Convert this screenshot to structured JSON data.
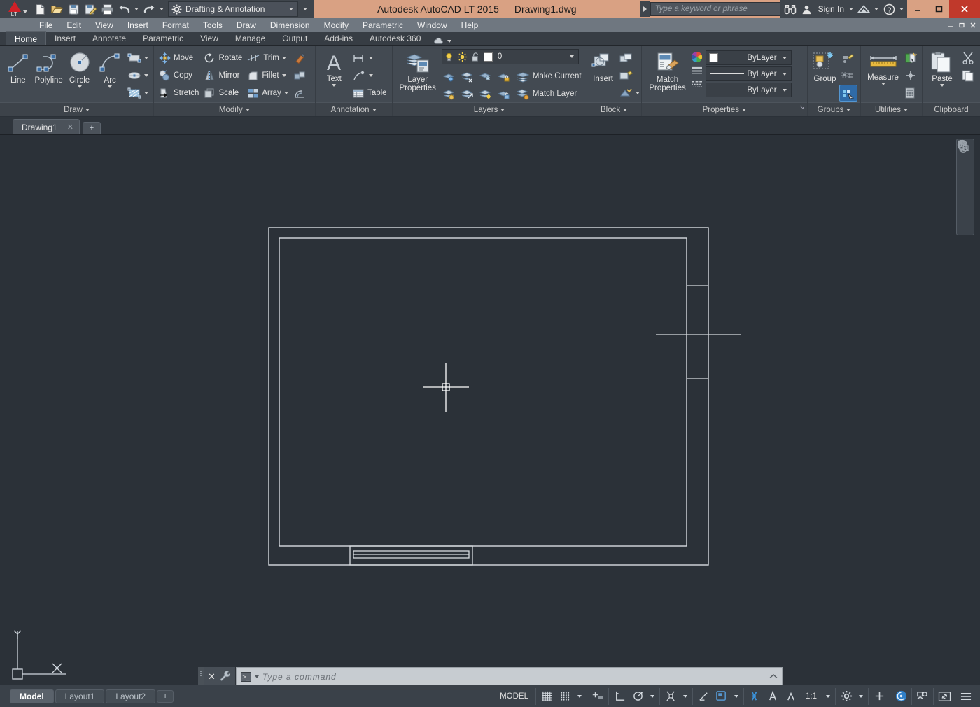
{
  "titlebar": {
    "workspace": "Drafting & Annotation",
    "app_title": "Autodesk AutoCAD LT 2015",
    "file_name": "Drawing1.dwg",
    "search_placeholder": "Type a keyword or phrase",
    "sign_in": "Sign In",
    "quick_access": [
      {
        "name": "new-file-icon",
        "label": "New"
      },
      {
        "name": "open-file-icon",
        "label": "Open"
      },
      {
        "name": "save-file-icon",
        "label": "Save"
      },
      {
        "name": "save-as-icon",
        "label": "Save As"
      },
      {
        "name": "plot-icon",
        "label": "Plot"
      },
      {
        "name": "undo-icon",
        "label": "Undo"
      },
      {
        "name": "redo-icon",
        "label": "Redo"
      }
    ],
    "window_buttons": [
      "minimize",
      "restore",
      "close"
    ]
  },
  "menubar": {
    "items": [
      "File",
      "Edit",
      "View",
      "Insert",
      "Format",
      "Tools",
      "Draw",
      "Dimension",
      "Modify",
      "Parametric",
      "Window",
      "Help"
    ]
  },
  "ribbon_tabs": {
    "items": [
      "Home",
      "Insert",
      "Annotate",
      "Parametric",
      "View",
      "Manage",
      "Output",
      "Add-ins",
      "Autodesk 360"
    ],
    "active": "Home"
  },
  "ribbon": {
    "panels": [
      {
        "title": "Draw",
        "big_buttons": [
          {
            "label": "Line",
            "icon": "line-icon",
            "dropdown": false
          },
          {
            "label": "Polyline",
            "icon": "polyline-icon",
            "dropdown": false
          },
          {
            "label": "Circle",
            "icon": "circle-icon",
            "dropdown": true
          },
          {
            "label": "Arc",
            "icon": "arc-icon",
            "dropdown": true
          }
        ],
        "small_buttons": [
          {
            "label": "",
            "icon": "rectangle-icon",
            "dropdown": true
          },
          {
            "label": "",
            "icon": "ellipse-icon",
            "dropdown": true
          },
          {
            "label": "",
            "icon": "hatch-icon",
            "dropdown": true
          }
        ]
      },
      {
        "title": "Modify",
        "small_buttons": [
          {
            "label": "Move",
            "icon": "move-icon"
          },
          {
            "label": "Rotate",
            "icon": "rotate-icon"
          },
          {
            "label": "Trim",
            "icon": "trim-icon",
            "dropdown": true
          },
          {
            "label": "Copy",
            "icon": "copy-icon"
          },
          {
            "label": "Mirror",
            "icon": "mirror-icon"
          },
          {
            "label": "Fillet",
            "icon": "fillet-icon",
            "dropdown": true
          },
          {
            "label": "Stretch",
            "icon": "stretch-icon"
          },
          {
            "label": "Scale",
            "icon": "scale-icon"
          },
          {
            "label": "Array",
            "icon": "array-icon",
            "dropdown": true
          }
        ],
        "extra_buttons": [
          {
            "label": "",
            "icon": "explode-icon"
          },
          {
            "label": "",
            "icon": "offset-icon"
          },
          {
            "label": "",
            "icon": "erase-icon"
          }
        ]
      },
      {
        "title": "Annotation",
        "big_buttons": [
          {
            "label": "Text",
            "icon": "text-icon",
            "dropdown": true
          }
        ],
        "small_buttons": [
          {
            "label": "",
            "icon": "dimension-icon",
            "dropdown": true
          },
          {
            "label": "",
            "icon": "leader-icon",
            "dropdown": true
          },
          {
            "label": "Table",
            "icon": "table-icon"
          }
        ]
      },
      {
        "title": "Layers",
        "big_buttons": [
          {
            "label": "Layer\nProperties",
            "icon": "layer-properties-icon"
          }
        ],
        "current_layer": "0",
        "layer_state_icons": [
          "lightbulb-on-icon",
          "sun-icon",
          "unlock-icon"
        ],
        "small_buttons": [
          {
            "label": "",
            "icon": "layer-isolate-icon"
          },
          {
            "label": "",
            "icon": "layer-freeze-icon"
          },
          {
            "label": "",
            "icon": "layer-off-icon"
          },
          {
            "label": "",
            "icon": "layer-lock-icon"
          },
          {
            "label": "Make Current",
            "icon": "make-current-icon"
          },
          {
            "label": "",
            "icon": "layer-unisolate-icon"
          },
          {
            "label": "",
            "icon": "layer-to-current-icon"
          },
          {
            "label": "",
            "icon": "layer-thaw-icon"
          },
          {
            "label": "",
            "icon": "layer-unlock-icon"
          },
          {
            "label": "Match Layer",
            "icon": "match-layer-icon"
          }
        ]
      },
      {
        "title": "Block",
        "big_buttons": [
          {
            "label": "Insert",
            "icon": "insert-block-icon"
          }
        ],
        "small_buttons": [
          {
            "label": "",
            "icon": "create-block-icon"
          },
          {
            "label": "",
            "icon": "edit-attribute-icon"
          },
          {
            "label": "",
            "icon": "define-attributes-icon",
            "dropdown": true
          }
        ]
      },
      {
        "title": "Properties",
        "big_buttons": [
          {
            "label": "Match\nProperties",
            "icon": "match-properties-icon"
          }
        ],
        "combos": [
          {
            "label": "ByLayer",
            "icon": "color-wheel-icon",
            "name": "object-color"
          },
          {
            "label": "ByLayer",
            "icon": "lineweight-icon",
            "name": "lineweight"
          },
          {
            "label": "ByLayer",
            "icon": "linetype-icon",
            "name": "linetype"
          }
        ]
      },
      {
        "title": "Groups",
        "big_buttons": [
          {
            "label": "Group",
            "icon": "group-icon"
          }
        ],
        "small_buttons": [
          {
            "label": "",
            "icon": "edit-group-icon"
          },
          {
            "label": "",
            "icon": "ungroup-icon"
          },
          {
            "label": "",
            "icon": "group-selection-on-icon",
            "active": true
          }
        ]
      },
      {
        "title": "Utilities",
        "big_buttons": [
          {
            "label": "Measure",
            "icon": "measure-icon",
            "dropdown": true
          }
        ],
        "small_buttons": [
          {
            "label": "",
            "icon": "quick-select-icon"
          },
          {
            "label": "",
            "icon": "point-style-icon"
          },
          {
            "label": "",
            "icon": "calculator-icon"
          }
        ]
      },
      {
        "title": "Clipboard",
        "big_buttons": [
          {
            "label": "Paste",
            "icon": "paste-icon",
            "dropdown": true
          }
        ],
        "small_buttons": [
          {
            "label": "",
            "icon": "cut-icon"
          },
          {
            "label": "",
            "icon": "copy-clip-icon"
          }
        ]
      }
    ]
  },
  "file_tabs": {
    "tabs": [
      {
        "label": "Drawing1",
        "close": "✕",
        "active": true
      }
    ],
    "add_label": "+"
  },
  "canvas": {
    "ucs": {
      "x_label": "X",
      "y_label": "Y"
    },
    "navbar": [
      {
        "name": "steering-wheel-icon"
      },
      {
        "name": "zoom-icon"
      },
      {
        "name": "pan-hand-icon"
      },
      {
        "name": "orbit-icon"
      },
      {
        "name": "navbar-menu-icon"
      }
    ]
  },
  "command_line": {
    "placeholder": "Type a command",
    "close_label": "✕",
    "tools": [
      "close-command-icon",
      "customize-wrench-icon"
    ],
    "prompt_icon": ">_"
  },
  "statusbar": {
    "layout_tabs": [
      {
        "label": "Model",
        "active": true
      },
      {
        "label": "Layout1",
        "active": false
      },
      {
        "label": "Layout2",
        "active": false
      }
    ],
    "add_layout": "+",
    "space_label": "MODEL",
    "annotation_scale": "1:1",
    "toggles": [
      {
        "name": "grid-display-toggle",
        "label": ""
      },
      {
        "name": "snap-mode-toggle",
        "label": ""
      },
      {
        "name": "snap-dropdown",
        "label": ""
      },
      {
        "name": "dynamic-input-toggle",
        "label": ""
      },
      {
        "name": "ortho-mode-toggle",
        "label": ""
      },
      {
        "name": "polar-tracking-toggle",
        "label": ""
      },
      {
        "name": "polar-dropdown",
        "label": ""
      },
      {
        "name": "object-snap-toggle",
        "label": ""
      },
      {
        "name": "osnap-dropdown",
        "label": ""
      },
      {
        "name": "object-snap-tracking-toggle",
        "label": ""
      },
      {
        "name": "lineweight-toggle",
        "label": ""
      },
      {
        "name": "transparency-toggle",
        "label": ""
      },
      {
        "name": "selection-cycling-toggle",
        "label": ""
      },
      {
        "name": "annotation-visibility-toggle",
        "label": ""
      },
      {
        "name": "autoscale-toggle",
        "label": ""
      },
      {
        "name": "annotation-scale",
        "label": "1:1"
      },
      {
        "name": "workspace-switching-icon",
        "label": ""
      },
      {
        "name": "hardware-acceleration-icon",
        "label": ""
      },
      {
        "name": "isolate-objects-icon",
        "label": ""
      },
      {
        "name": "fullscreen-icon",
        "label": ""
      },
      {
        "name": "customization-menu-icon",
        "label": ""
      }
    ]
  },
  "colors": {
    "titlebar": "#d9a183",
    "ribbon": "#434a52",
    "canvas": "#2b3138",
    "accent_blue": "#3b8fd4",
    "close_red": "#c0392b",
    "drawing_line": "#d8dce0"
  }
}
